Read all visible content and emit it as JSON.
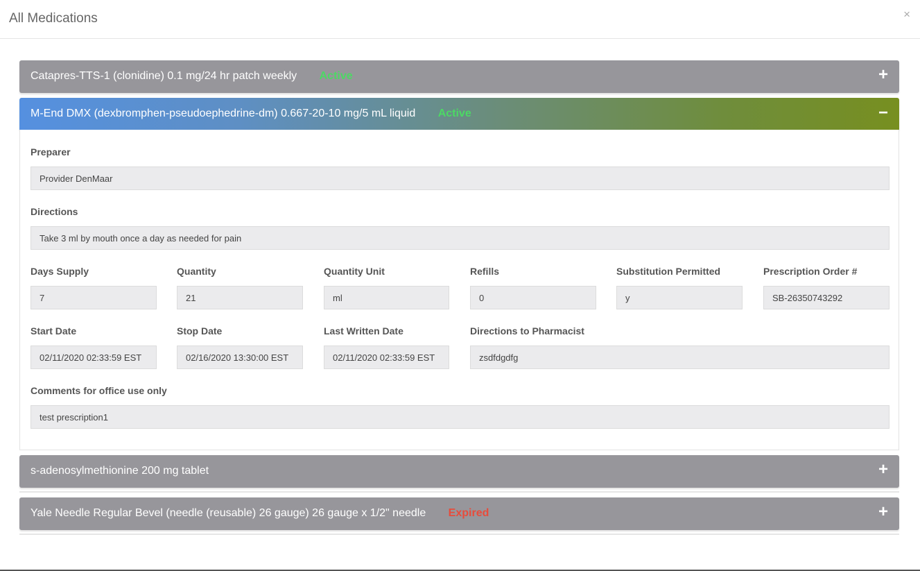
{
  "modal": {
    "title": "All Medications",
    "close_glyph": "×"
  },
  "colors": {
    "active": "#4cd964",
    "expired": "#e74c3c",
    "collapsed_header": "#97969b"
  },
  "icons": {
    "expand": "plus-icon",
    "collapse": "minus-icon"
  },
  "medications": [
    {
      "name": "Catapres-TTS-1 (clonidine) 0.1 mg/24 hr patch weekly",
      "status": "Active",
      "toggle": "+"
    },
    {
      "name": "M-End DMX (dexbromphen-pseudoephedrine-dm) 0.667-20-10 mg/5 mL liquid",
      "status": "Active",
      "toggle": "−"
    },
    {
      "name": "s-adenosylmethionine 200 mg tablet",
      "status": "",
      "toggle": "+"
    },
    {
      "name": "Yale Needle Regular Bevel (needle (reusable) 26 gauge) 26 gauge x 1/2\" needle",
      "status": "Expired",
      "toggle": "+"
    }
  ],
  "details": {
    "preparer": {
      "label": "Preparer",
      "value": "Provider DenMaar"
    },
    "directions": {
      "label": "Directions",
      "value": "Take 3 ml by mouth once a day as needed for pain"
    },
    "days_supply": {
      "label": "Days Supply",
      "value": "7"
    },
    "quantity": {
      "label": "Quantity",
      "value": "21"
    },
    "quantity_unit": {
      "label": "Quantity Unit",
      "value": "ml"
    },
    "refills": {
      "label": "Refills",
      "value": "0"
    },
    "substitution": {
      "label": "Substitution Permitted",
      "value": "y"
    },
    "order_no": {
      "label": "Prescription Order #",
      "value": "SB-26350743292"
    },
    "start_date": {
      "label": "Start Date",
      "value": "02/11/2020 02:33:59 EST"
    },
    "stop_date": {
      "label": "Stop Date",
      "value": "02/16/2020 13:30:00 EST"
    },
    "last_written": {
      "label": "Last Written Date",
      "value": "02/11/2020 02:33:59 EST"
    },
    "pharmacist_directions": {
      "label": "Directions to Pharmacist",
      "value": "zsdfdgdfg"
    },
    "comments": {
      "label": "Comments for office use only",
      "value": "test prescription1"
    }
  }
}
